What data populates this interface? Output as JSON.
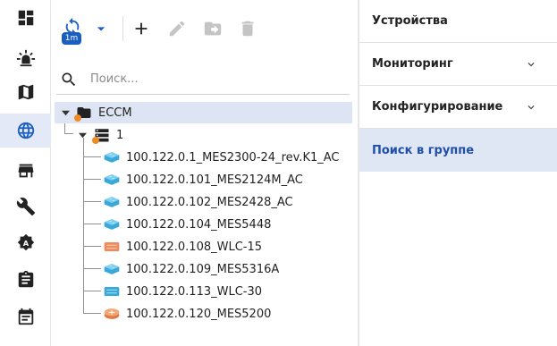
{
  "nav": {
    "items": [
      {
        "name": "dashboard-icon",
        "active": false
      },
      {
        "name": "alarm-icon",
        "active": false
      },
      {
        "name": "map-icon",
        "active": false
      },
      {
        "name": "globe-icon",
        "active": true
      },
      {
        "name": "store-icon",
        "active": false
      },
      {
        "name": "wrench-icon",
        "active": false
      },
      {
        "name": "admin-badge-icon",
        "active": false
      },
      {
        "name": "clipboard-icon",
        "active": false
      },
      {
        "name": "calendar-icon",
        "active": false
      }
    ]
  },
  "toolbar": {
    "refresh_interval": "1m",
    "icons": [
      "refresh-icon",
      "dropdown-arrow-icon",
      "add-icon",
      "edit-icon",
      "move-folder-icon",
      "delete-icon"
    ]
  },
  "search": {
    "placeholder": "Поиск..."
  },
  "tree": {
    "root": {
      "label": "ECCM"
    },
    "group": {
      "label": "1"
    },
    "devices": [
      {
        "label": "100.122.0.1_MES2300-24_rev.K1_AC",
        "kind": "switch"
      },
      {
        "label": "100.122.0.101_MES2124M_AC",
        "kind": "switch"
      },
      {
        "label": "100.122.0.102_MES2428_AC",
        "kind": "switch"
      },
      {
        "label": "100.122.0.104_MES5448",
        "kind": "switch"
      },
      {
        "label": "100.122.0.108_WLC-15",
        "kind": "wlc-alarm"
      },
      {
        "label": "100.122.0.109_MES5316A",
        "kind": "switch"
      },
      {
        "label": "100.122.0.113_WLC-30",
        "kind": "wlc"
      },
      {
        "label": "100.122.0.120_MES5200",
        "kind": "router"
      }
    ]
  },
  "right_panel": {
    "devices": "Устройства",
    "monitoring": "Мониторинг",
    "configuration": "Конфигурирование",
    "group_search": "Поиск в группе"
  },
  "colors": {
    "accent": "#1a5fbf",
    "active_bg": "#dfe6f4",
    "alarm_dot": "#f08a24",
    "switch_icon": "#3aa8d8",
    "wlc_alarm_icon": "#ef8a5a"
  }
}
